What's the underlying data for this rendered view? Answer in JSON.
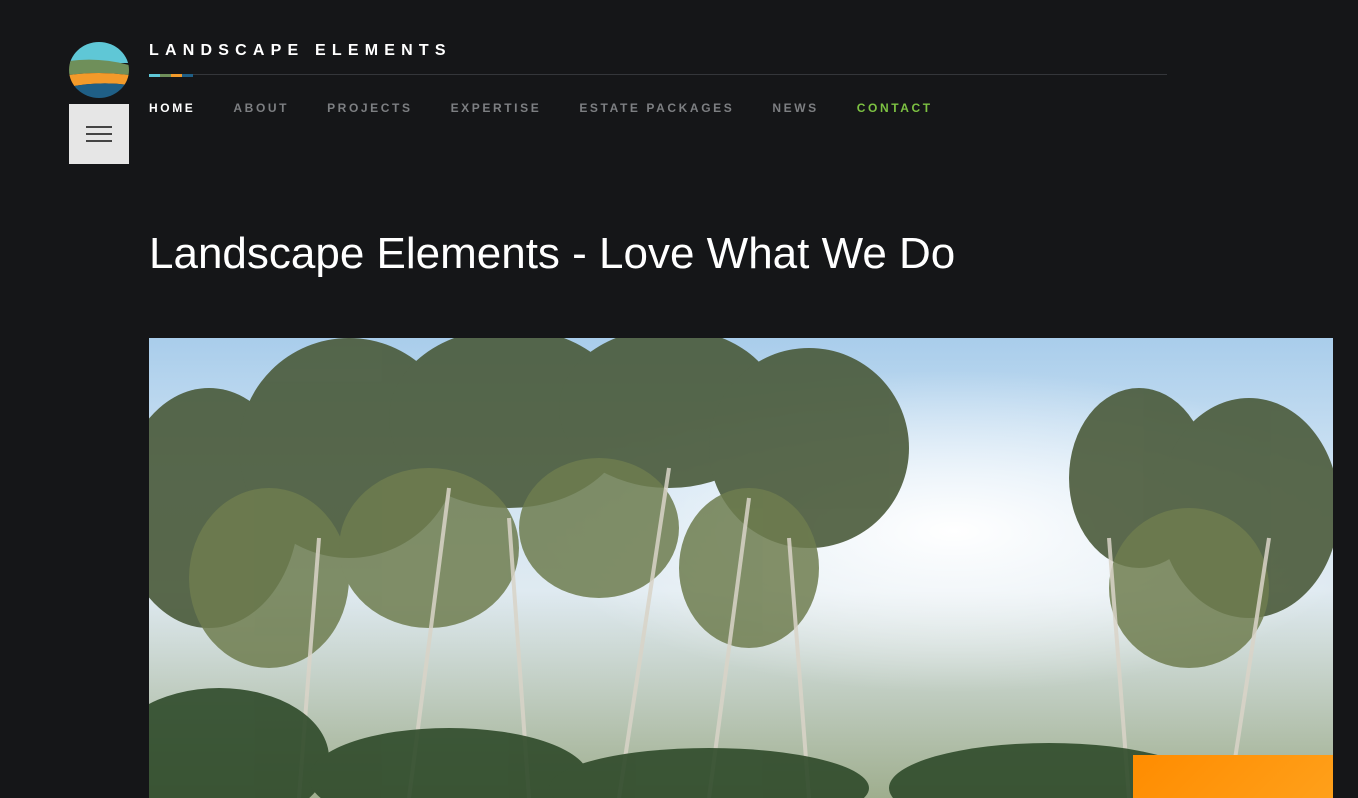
{
  "brand": {
    "name": "LANDSCAPE ELEMENTS",
    "logo_icon": "landscape-stone-logo",
    "stripe_colors": [
      "#5fc7d6",
      "#6f8f5a",
      "#f39a2a",
      "#1f5f86"
    ]
  },
  "menu_button": {
    "icon": "hamburger-icon"
  },
  "nav": {
    "items": [
      {
        "label": "HOME",
        "active": true
      },
      {
        "label": "ABOUT"
      },
      {
        "label": "PROJECTS"
      },
      {
        "label": "EXPERTISE"
      },
      {
        "label": "ESTATE PACKAGES"
      },
      {
        "label": "NEWS"
      },
      {
        "label": "CONTACT",
        "accent": "#7cc142"
      }
    ]
  },
  "page": {
    "title": "Landscape Elements - Love What We Do"
  },
  "colors": {
    "background": "#151618",
    "accent_green": "#7cc142",
    "accent_orange": "#ff8c00"
  }
}
